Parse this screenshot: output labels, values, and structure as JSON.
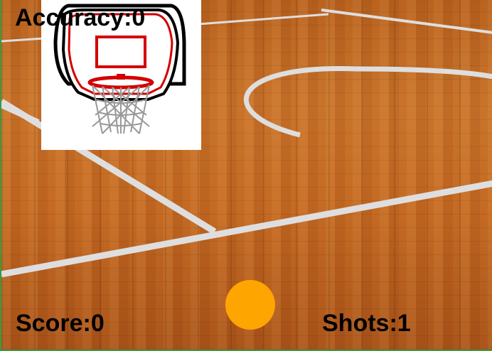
{
  "hud": {
    "accuracy_label": "Accuracy:",
    "accuracy_value": "0",
    "score_label": "Score:",
    "score_value": "0",
    "shots_label": "Shots:",
    "shots_value": "1"
  },
  "colors": {
    "ball": "#ffa500",
    "hoop_red": "#d40000",
    "court_line": "#dcdcdc",
    "text": "#000000"
  },
  "icons": {
    "hoop": "basketball-hoop-icon",
    "ball": "basketball"
  }
}
